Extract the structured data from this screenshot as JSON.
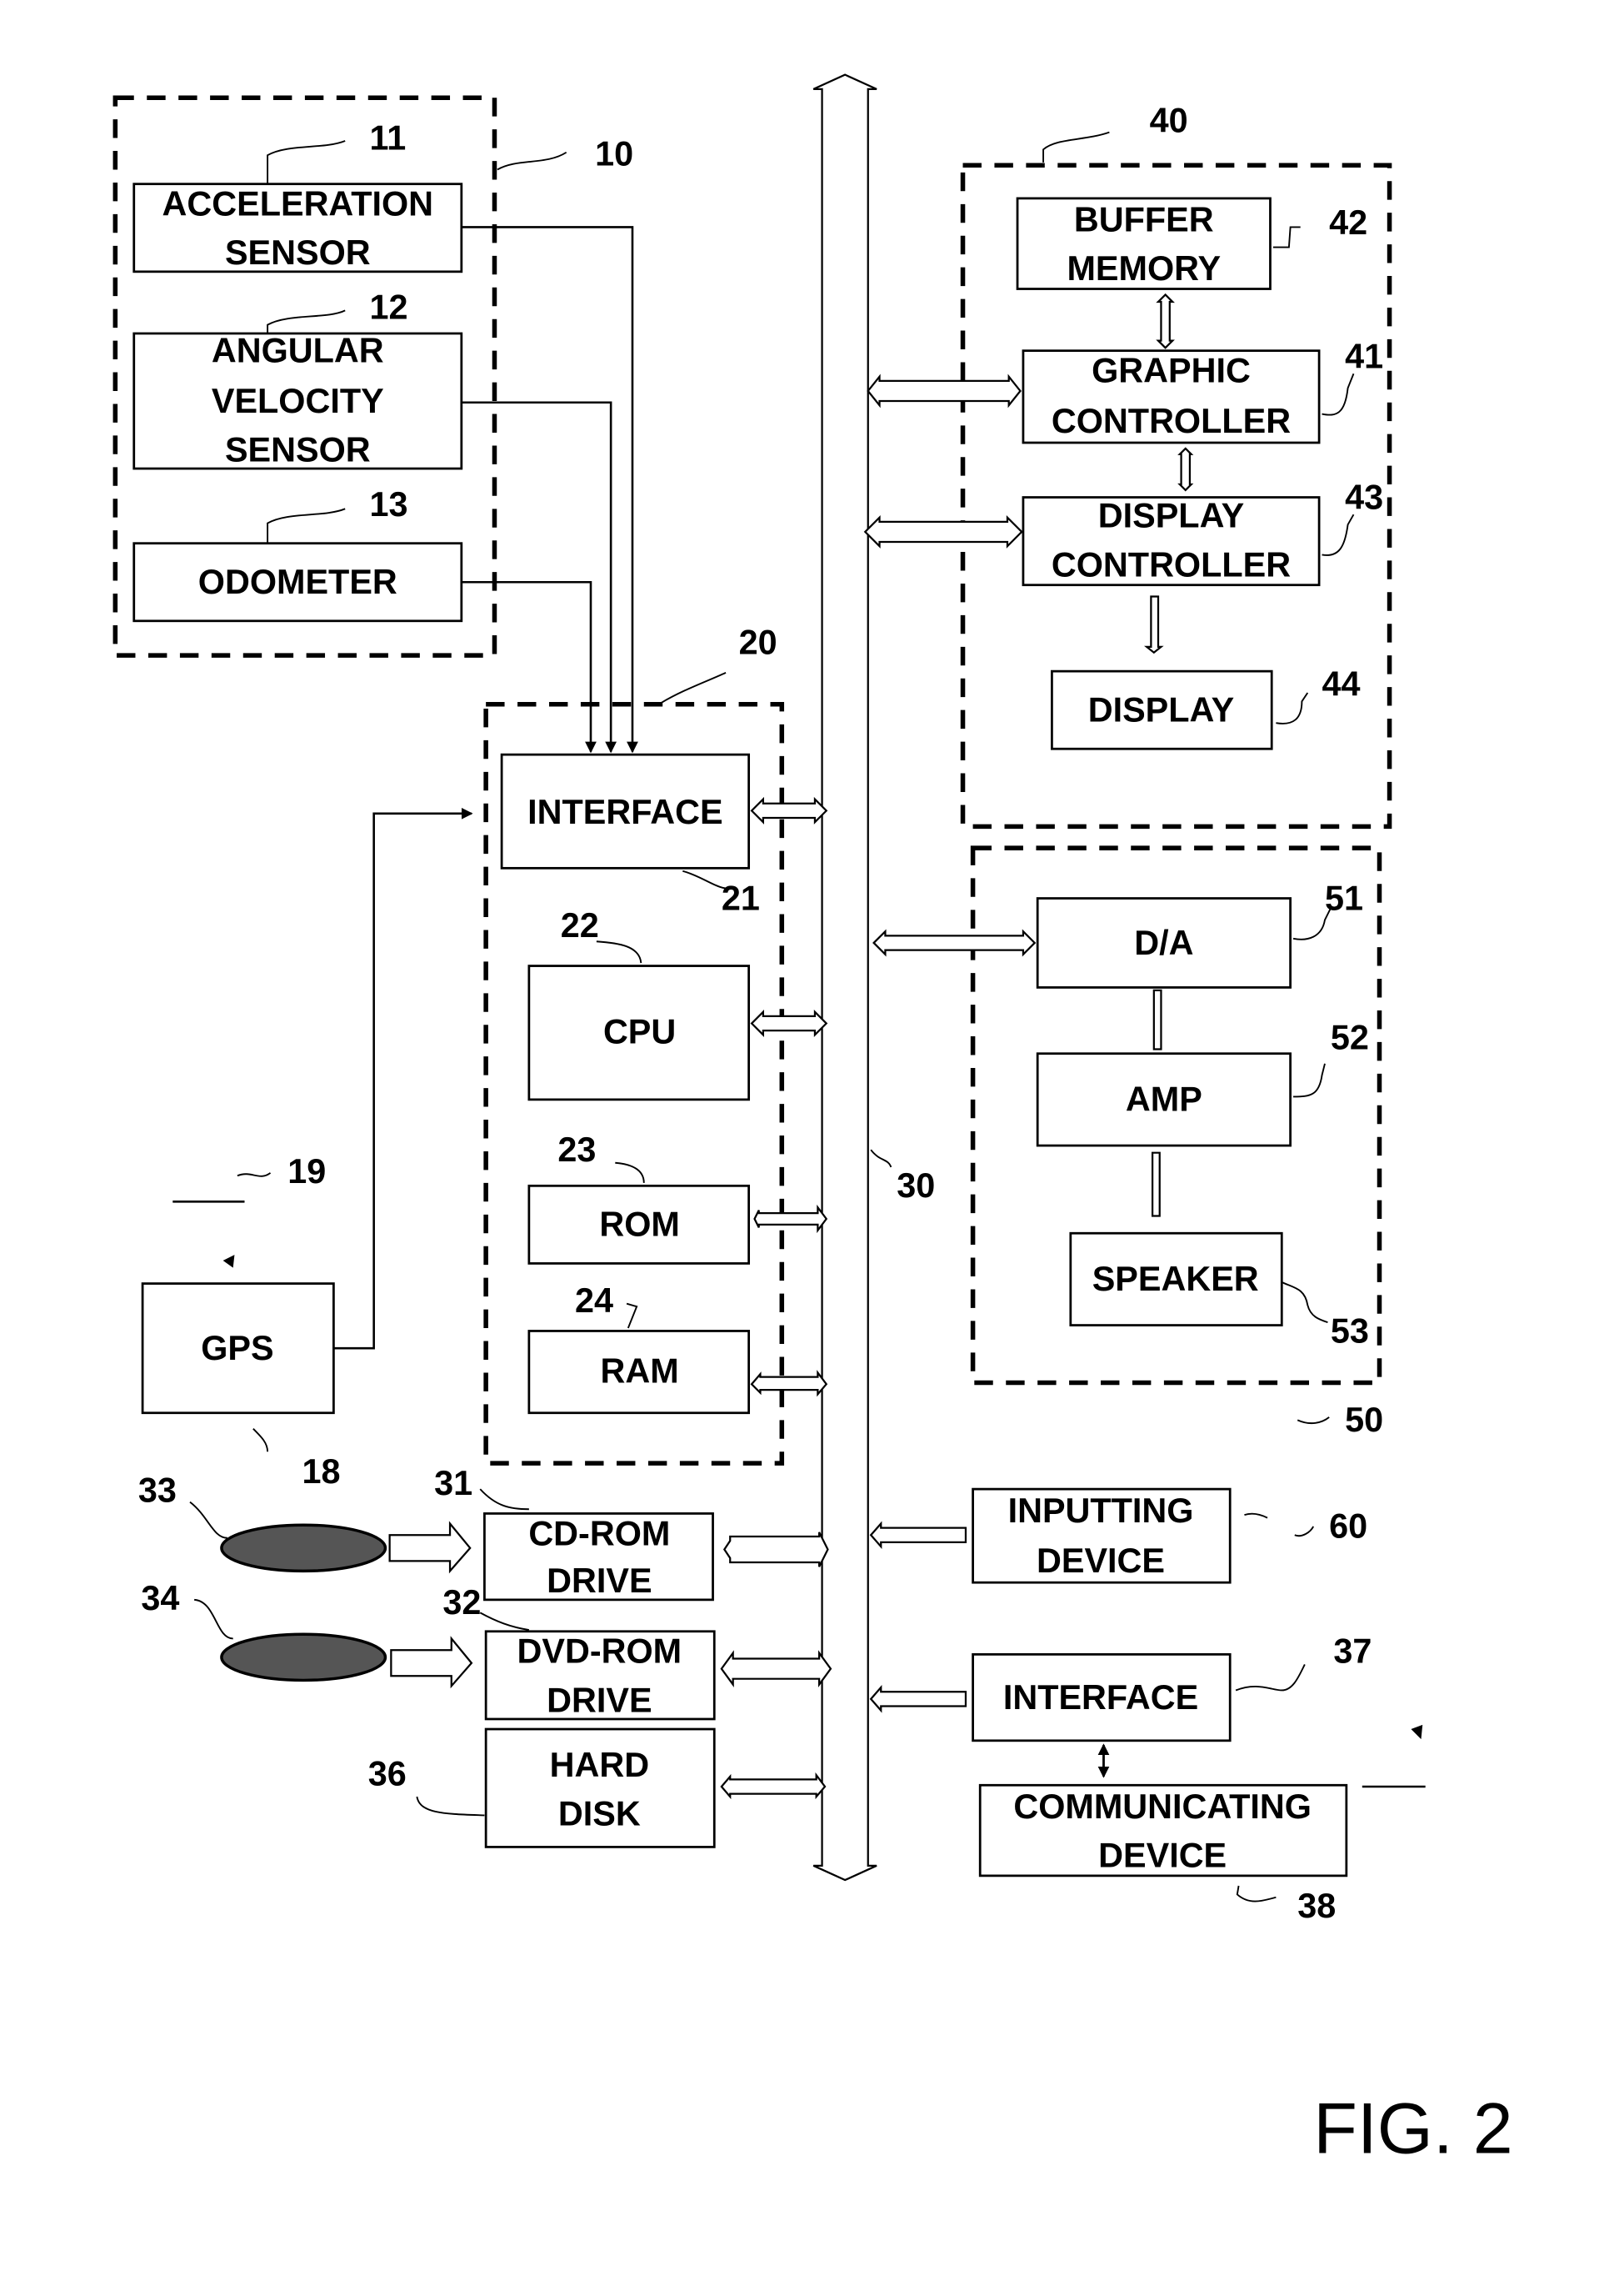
{
  "figure": {
    "title": "FIG. 2"
  },
  "bus": {
    "ref": "30"
  },
  "groups": {
    "sensors": {
      "ref": "10"
    },
    "controller": {
      "ref": "20"
    },
    "display_unit": {
      "ref": "40"
    },
    "audio_unit": {
      "ref": "50"
    }
  },
  "blocks": {
    "acceleration_sensor": {
      "lines": [
        "ACCELERATION",
        "SENSOR"
      ],
      "ref": "11"
    },
    "angular_velocity_sensor": {
      "lines": [
        "ANGULAR",
        "VELOCITY",
        "SENSOR"
      ],
      "ref": "12"
    },
    "odometer": {
      "lines": [
        "ODOMETER"
      ],
      "ref": "13"
    },
    "gps": {
      "lines": [
        "GPS"
      ],
      "ref": "18",
      "antenna_ref": "19"
    },
    "interface_21": {
      "lines": [
        "INTERFACE"
      ],
      "ref": "21"
    },
    "cpu": {
      "lines": [
        "CPU"
      ],
      "ref": "22"
    },
    "rom": {
      "lines": [
        "ROM"
      ],
      "ref": "23"
    },
    "ram": {
      "lines": [
        "RAM"
      ],
      "ref": "24"
    },
    "cd_rom_drive": {
      "lines": [
        "CD-ROM",
        "DRIVE"
      ],
      "ref": "31"
    },
    "dvd_rom_drive": {
      "lines": [
        "DVD-ROM",
        "DRIVE"
      ],
      "ref": "32"
    },
    "cd_disc": {
      "ref": "33"
    },
    "dvd_disc": {
      "ref": "34"
    },
    "hard_disk": {
      "lines": [
        "HARD",
        "DISK"
      ],
      "ref": "36"
    },
    "buffer_memory": {
      "lines": [
        "BUFFER",
        "MEMORY"
      ],
      "ref": "42"
    },
    "graphic_controller": {
      "lines": [
        "GRAPHIC",
        "CONTROLLER"
      ],
      "ref": "41"
    },
    "display_controller": {
      "lines": [
        "DISPLAY",
        "CONTROLLER"
      ],
      "ref": "43"
    },
    "display": {
      "lines": [
        "DISPLAY"
      ],
      "ref": "44"
    },
    "d_a": {
      "lines": [
        "D/A"
      ],
      "ref": "51"
    },
    "amp": {
      "lines": [
        "AMP"
      ],
      "ref": "52"
    },
    "speaker": {
      "lines": [
        "SPEAKER"
      ],
      "ref": "53"
    },
    "inputting_device": {
      "lines": [
        "INPUTTING",
        "DEVICE"
      ],
      "ref": "60"
    },
    "interface_37": {
      "lines": [
        "INTERFACE"
      ],
      "ref": "37"
    },
    "communicating_device": {
      "lines": [
        "COMMUNICATING",
        "DEVICE"
      ],
      "ref": "38"
    }
  }
}
